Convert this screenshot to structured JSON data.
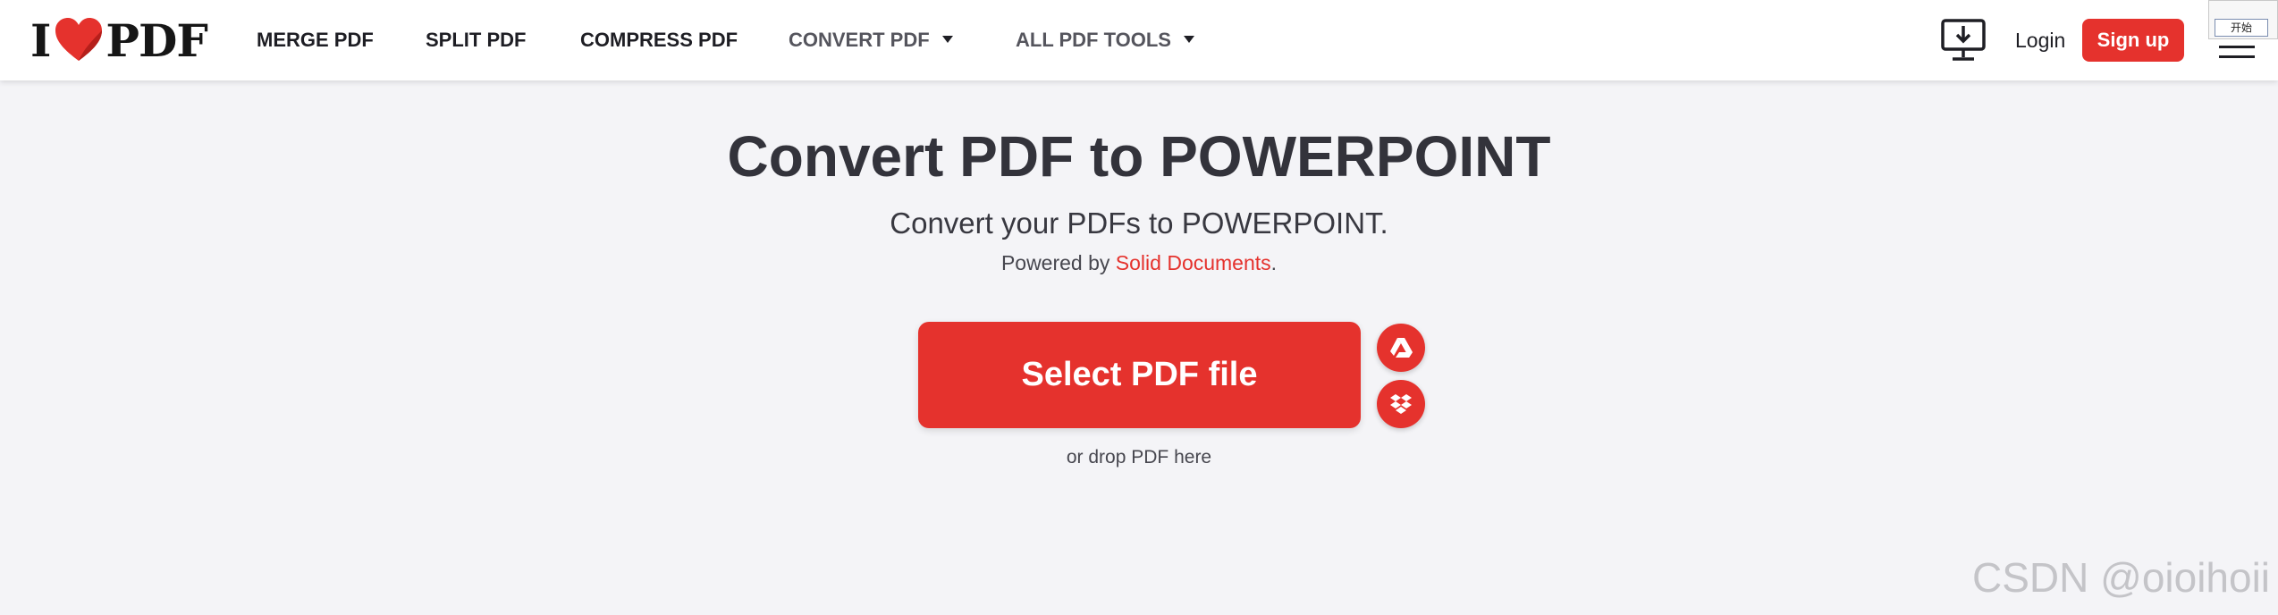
{
  "brand": {
    "logo_left": "I",
    "logo_right": "PDF",
    "accent_color": "#e5322d"
  },
  "nav": {
    "items": [
      {
        "label": "MERGE PDF"
      },
      {
        "label": "SPLIT PDF"
      },
      {
        "label": "COMPRESS PDF"
      },
      {
        "label": "CONVERT PDF"
      },
      {
        "label": "ALL PDF TOOLS"
      }
    ]
  },
  "header_right": {
    "desktop_icon": "desktop-download-icon",
    "login_label": "Login",
    "signup_label": "Sign up",
    "menu_icon": "hamburger-menu-icon"
  },
  "overlay": {
    "button_label": "开始"
  },
  "main": {
    "title": "Convert PDF to POWERPOINT",
    "subtitle": "Convert your PDFs to POWERPOINT.",
    "powered_prefix": "Powered by ",
    "powered_link": "Solid Documents",
    "powered_suffix": ".",
    "select_label": "Select PDF file",
    "drop_text": "or drop PDF here",
    "cloud_icons": [
      "google-drive-icon",
      "dropbox-icon"
    ]
  },
  "watermark": "CSDN @oioihoii"
}
